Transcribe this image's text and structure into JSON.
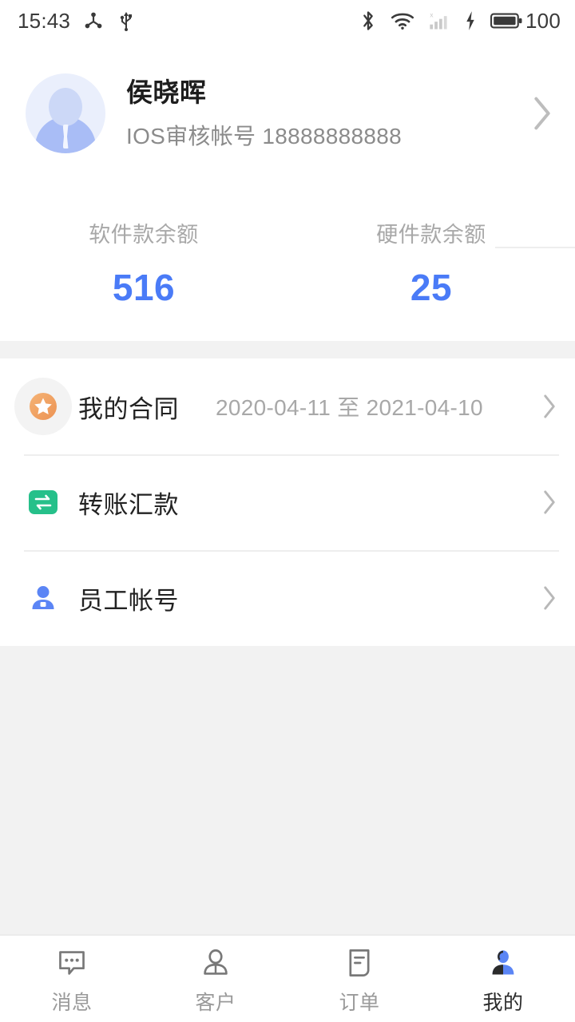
{
  "status_bar": {
    "time": "15:43",
    "left_icons": [
      "debug-share-icon",
      "usb-icon"
    ],
    "right_icons": [
      "bluetooth-icon",
      "wifi-icon",
      "signal-icon",
      "charging-icon",
      "battery-icon"
    ],
    "battery_level": "100"
  },
  "profile": {
    "name": "侯晓晖",
    "subtitle": "IOS审核帐号 18888888888",
    "avatar": "default-avatar-icon",
    "chevron": "chevron-right-icon"
  },
  "balances": [
    {
      "label": "软件款余额",
      "value": "516"
    },
    {
      "label": "硬件款余额",
      "value": "25"
    }
  ],
  "menu": [
    {
      "icon": "star-badge-icon",
      "label": "我的合同",
      "value": "2020-04-11 至 2021-04-10",
      "chevron": "chevron-right-icon"
    },
    {
      "icon": "transfer-icon",
      "label": "转账汇款",
      "value": "",
      "chevron": "chevron-right-icon"
    },
    {
      "icon": "employee-icon",
      "label": "员工帐号",
      "value": "",
      "chevron": "chevron-right-icon"
    }
  ],
  "tabs": [
    {
      "label": "消息",
      "icon": "message-icon",
      "active": false
    },
    {
      "label": "客户",
      "icon": "customer-icon",
      "active": false
    },
    {
      "label": "订单",
      "icon": "order-icon",
      "active": false
    },
    {
      "label": "我的",
      "icon": "profile-icon",
      "active": true
    }
  ],
  "colors": {
    "accent_blue": "#4a7bf7",
    "star_orange": "#f0a060",
    "transfer_green": "#26c08a",
    "page_bg": "#f2f2f2",
    "card_bg": "#ffffff",
    "muted_text": "#a8a8a8"
  }
}
